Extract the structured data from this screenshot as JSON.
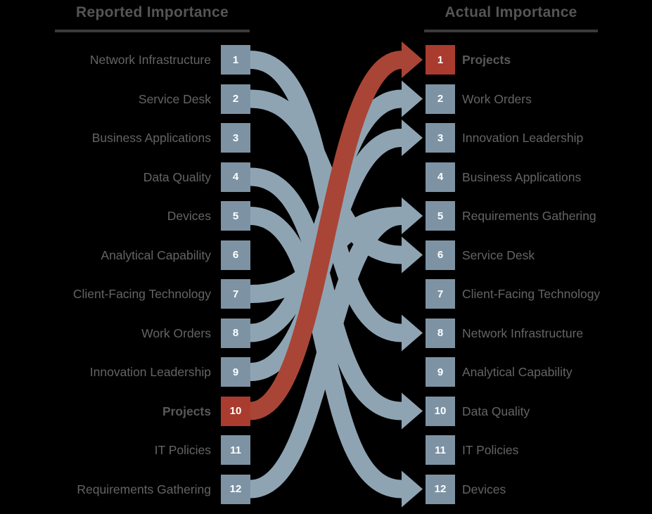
{
  "colors": {
    "background": "#000000",
    "node_blue": "#7d93a4",
    "node_red": "#a93c2e",
    "arrow_blue": "#8fa4b3",
    "arrow_red": "#a94536",
    "header_text": "#555556",
    "label_text": "#636466",
    "rule": "#3a3a3a"
  },
  "headers": {
    "left": "Reported Importance",
    "right": "Actual Importance"
  },
  "left_column": [
    {
      "rank": "1",
      "label": "Network Infrastructure",
      "highlight": false
    },
    {
      "rank": "2",
      "label": "Service Desk",
      "highlight": false
    },
    {
      "rank": "3",
      "label": "Business Applications",
      "highlight": false
    },
    {
      "rank": "4",
      "label": "Data Quality",
      "highlight": false
    },
    {
      "rank": "5",
      "label": "Devices",
      "highlight": false
    },
    {
      "rank": "6",
      "label": "Analytical  Capability",
      "highlight": false
    },
    {
      "rank": "7",
      "label": "Client-Facing Technology",
      "highlight": false
    },
    {
      "rank": "8",
      "label": "Work Orders",
      "highlight": false
    },
    {
      "rank": "9",
      "label": "Innovation  Leadership",
      "highlight": false
    },
    {
      "rank": "10",
      "label": "Projects",
      "highlight": true
    },
    {
      "rank": "11",
      "label": "IT Policies",
      "highlight": false
    },
    {
      "rank": "12",
      "label": "Requirements Gathering",
      "highlight": false
    }
  ],
  "right_column": [
    {
      "rank": "1",
      "label": "Projects",
      "highlight": true
    },
    {
      "rank": "2",
      "label": "Work Orders",
      "highlight": false
    },
    {
      "rank": "3",
      "label": "Innovation  Leadership",
      "highlight": false
    },
    {
      "rank": "4",
      "label": "Business Applications",
      "highlight": false
    },
    {
      "rank": "5",
      "label": "Requirements  Gathering",
      "highlight": false
    },
    {
      "rank": "6",
      "label": "Service Desk",
      "highlight": false
    },
    {
      "rank": "7",
      "label": "Client-Facing  Technology",
      "highlight": false
    },
    {
      "rank": "8",
      "label": "Network Infrastructure",
      "highlight": false
    },
    {
      "rank": "9",
      "label": "Analytical  Capability",
      "highlight": false
    },
    {
      "rank": "10",
      "label": "Data Quality",
      "highlight": false
    },
    {
      "rank": "11",
      "label": "IT Policies",
      "highlight": false
    },
    {
      "rank": "12",
      "label": "Devices",
      "highlight": false
    }
  ],
  "connections": [
    {
      "item": "Network Infrastructure",
      "from_rank": 1,
      "to_rank": 8,
      "color": "blue"
    },
    {
      "item": "Service Desk",
      "from_rank": 2,
      "to_rank": 6,
      "color": "blue"
    },
    {
      "item": "Data Quality",
      "from_rank": 4,
      "to_rank": 10,
      "color": "blue"
    },
    {
      "item": "Devices",
      "from_rank": 5,
      "to_rank": 12,
      "color": "blue"
    },
    {
      "item": "Client-Facing Technology",
      "from_rank": 7,
      "to_rank": 5,
      "color": "blue"
    },
    {
      "item": "Work Orders",
      "from_rank": 8,
      "to_rank": 2,
      "color": "blue"
    },
    {
      "item": "Innovation Leadership",
      "from_rank": 9,
      "to_rank": 3,
      "color": "blue"
    },
    {
      "item": "Projects",
      "from_rank": 10,
      "to_rank": 1,
      "color": "red"
    },
    {
      "item": "Requirements Gathering",
      "from_rank": 12,
      "to_rank": 5,
      "color": "blue"
    }
  ]
}
